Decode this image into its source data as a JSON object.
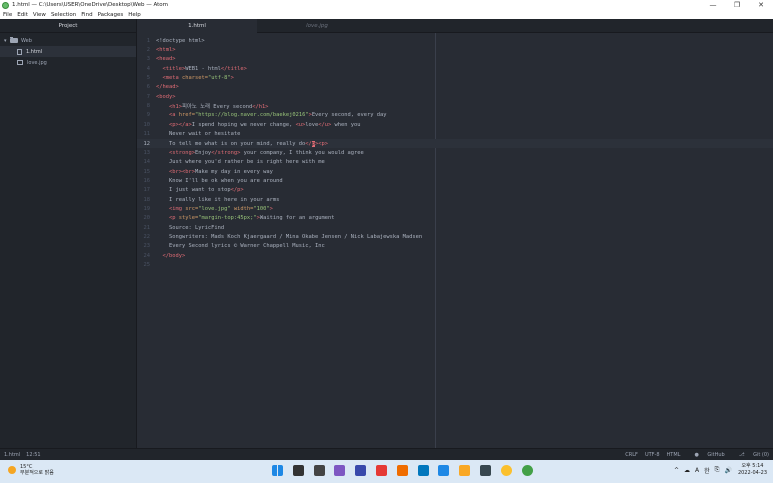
{
  "window": {
    "title": "1.html — C:\\Users\\USER\\OneDrive\\Desktop\\Web — Atom",
    "controls": [
      "—",
      "❐",
      "✕"
    ]
  },
  "menu": [
    "File",
    "Edit",
    "View",
    "Selection",
    "Find",
    "Packages",
    "Help"
  ],
  "sidebar": {
    "header": "Project",
    "root": "Web",
    "files": [
      "1.html",
      "love.jpg"
    ]
  },
  "tabs": [
    {
      "label": "1.html",
      "active": true
    },
    {
      "label": "love.jpg",
      "active": false
    }
  ],
  "editor": {
    "cursor_line": 12,
    "lines": [
      [
        {
          "c": "tx",
          "t": "<!doctype html>"
        }
      ],
      [
        {
          "c": "tg",
          "t": "<html>"
        }
      ],
      [
        {
          "c": "tg",
          "t": "<head>"
        }
      ],
      [
        {
          "c": "tx",
          "t": "  "
        },
        {
          "c": "tg",
          "t": "<title>"
        },
        {
          "c": "tx",
          "t": "WEB1 - html"
        },
        {
          "c": "tg",
          "t": "</title>"
        }
      ],
      [
        {
          "c": "tx",
          "t": "  "
        },
        {
          "c": "tg",
          "t": "<meta "
        },
        {
          "c": "at",
          "t": "charset="
        },
        {
          "c": "st",
          "t": "\"utf-8\""
        },
        {
          "c": "tg",
          "t": ">"
        }
      ],
      [
        {
          "c": "tg",
          "t": "</head>"
        }
      ],
      [
        {
          "c": "tg",
          "t": "<body>"
        }
      ],
      [
        {
          "c": "tx",
          "t": "    "
        },
        {
          "c": "tg",
          "t": "<h1>"
        },
        {
          "c": "tx",
          "t": "피아노 노래 Every second"
        },
        {
          "c": "tg",
          "t": "</h1>"
        }
      ],
      [
        {
          "c": "tx",
          "t": "    "
        },
        {
          "c": "tg",
          "t": "<a "
        },
        {
          "c": "at",
          "t": "href="
        },
        {
          "c": "st",
          "t": "\"https://blog.naver.com/baekej0216\""
        },
        {
          "c": "tg",
          "t": ">"
        },
        {
          "c": "tx",
          "t": "Every second, every day"
        }
      ],
      [
        {
          "c": "tx",
          "t": "    "
        },
        {
          "c": "tg",
          "t": "<p></a>"
        },
        {
          "c": "tx",
          "t": "I spend hoping we never change, "
        },
        {
          "c": "tg",
          "t": "<u>"
        },
        {
          "c": "tx",
          "t": "love"
        },
        {
          "c": "tg",
          "t": "</u>"
        },
        {
          "c": "tx",
          "t": " when you"
        }
      ],
      [
        {
          "c": "tx",
          "t": "    Never wait or hesitate"
        }
      ],
      [
        {
          "c": "tx",
          "t": "    To tell me what is on your mind, really do"
        },
        {
          "c": "tg",
          "t": "</"
        },
        {
          "c": "cur",
          "t": "p"
        },
        {
          "c": "tg",
          "t": "><p>"
        }
      ],
      [
        {
          "c": "tx",
          "t": "    "
        },
        {
          "c": "tg",
          "t": "<strong>"
        },
        {
          "c": "tx",
          "t": "Enjoy"
        },
        {
          "c": "tg",
          "t": "</strong>"
        },
        {
          "c": "tx",
          "t": " your company, I think you would agree"
        }
      ],
      [
        {
          "c": "tx",
          "t": "    Just where you'd rather be is right here with me"
        }
      ],
      [
        {
          "c": "tx",
          "t": "    "
        },
        {
          "c": "tg",
          "t": "<br><br>"
        },
        {
          "c": "tx",
          "t": "Make my day in every way"
        }
      ],
      [
        {
          "c": "tx",
          "t": "    Know I'll be ok when you are around"
        }
      ],
      [
        {
          "c": "tx",
          "t": "    I just want to stop"
        },
        {
          "c": "tg",
          "t": "</p>"
        }
      ],
      [
        {
          "c": "tx",
          "t": "    I really like it here in your arms"
        }
      ],
      [
        {
          "c": "tx",
          "t": "    "
        },
        {
          "c": "tg",
          "t": "<img "
        },
        {
          "c": "at",
          "t": "src="
        },
        {
          "c": "st",
          "t": "\"love.jpg\""
        },
        {
          "c": "at",
          "t": " width="
        },
        {
          "c": "st",
          "t": "\"100\""
        },
        {
          "c": "tg",
          "t": ">"
        }
      ],
      [
        {
          "c": "tx",
          "t": "    "
        },
        {
          "c": "tg",
          "t": "<p "
        },
        {
          "c": "at",
          "t": "style="
        },
        {
          "c": "st",
          "t": "\"margin-top:45px;\""
        },
        {
          "c": "tg",
          "t": ">"
        },
        {
          "c": "tx",
          "t": "Waiting for an argument"
        }
      ],
      [
        {
          "c": "tx",
          "t": "    Source: LyricFind"
        }
      ],
      [
        {
          "c": "tx",
          "t": "    Songwriters: Mads Koch Kjaergaard / Mina Okabe Jensen / Nick Labajewska Madsen"
        }
      ],
      [
        {
          "c": "tx",
          "t": "    Every Second lyrics © Warner Chappell Music, Inc"
        }
      ],
      [
        {
          "c": "tx",
          "t": "  "
        },
        {
          "c": "tg",
          "t": "</body>"
        }
      ],
      []
    ]
  },
  "status": {
    "file": "1.html",
    "position": "12:51",
    "line_ending": "CRLF",
    "encoding": "UTF-8",
    "grammar": "HTML",
    "github": "GitHub",
    "git": "Git (0)"
  },
  "taskbar": {
    "temp": "15°C",
    "weather": "부분적으로 맑음",
    "icon_colors": [
      "#1e88e5",
      "#333333",
      "#444444",
      "#7e57c2",
      "#3949ab",
      "#e53935",
      "#ef6c00",
      "#0277bd",
      "#1e88e5",
      "#f9a825",
      "#37474f",
      "#fbc02d",
      "#43a047"
    ],
    "tray": [
      "^",
      "☁",
      "A",
      "한",
      "⎘",
      "🔊"
    ],
    "time": "오후 5:14",
    "date": "2022-04-23"
  }
}
